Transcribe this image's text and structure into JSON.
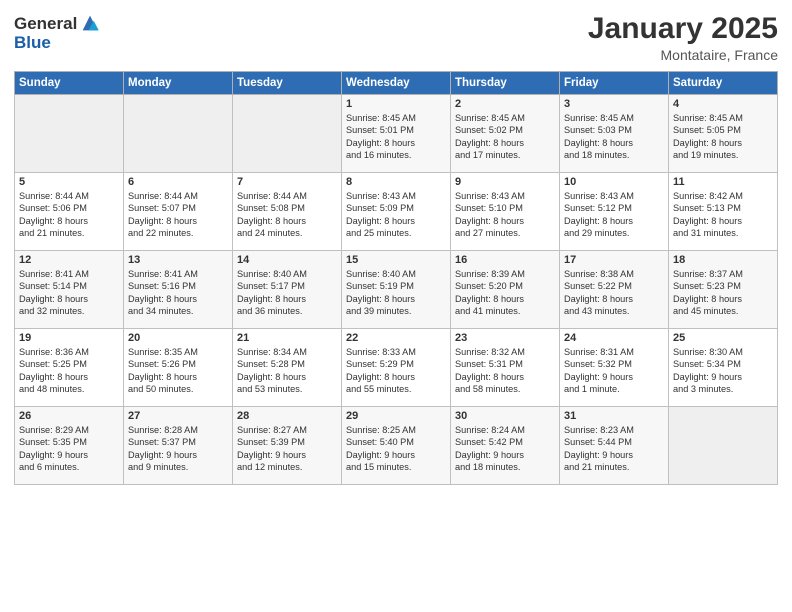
{
  "header": {
    "logo_general": "General",
    "logo_blue": "Blue",
    "month_title": "January 2025",
    "location": "Montataire, France"
  },
  "days_of_week": [
    "Sunday",
    "Monday",
    "Tuesday",
    "Wednesday",
    "Thursday",
    "Friday",
    "Saturday"
  ],
  "weeks": [
    [
      {
        "day": "",
        "content": ""
      },
      {
        "day": "",
        "content": ""
      },
      {
        "day": "",
        "content": ""
      },
      {
        "day": "1",
        "content": "Sunrise: 8:45 AM\nSunset: 5:01 PM\nDaylight: 8 hours\nand 16 minutes."
      },
      {
        "day": "2",
        "content": "Sunrise: 8:45 AM\nSunset: 5:02 PM\nDaylight: 8 hours\nand 17 minutes."
      },
      {
        "day": "3",
        "content": "Sunrise: 8:45 AM\nSunset: 5:03 PM\nDaylight: 8 hours\nand 18 minutes."
      },
      {
        "day": "4",
        "content": "Sunrise: 8:45 AM\nSunset: 5:05 PM\nDaylight: 8 hours\nand 19 minutes."
      }
    ],
    [
      {
        "day": "5",
        "content": "Sunrise: 8:44 AM\nSunset: 5:06 PM\nDaylight: 8 hours\nand 21 minutes."
      },
      {
        "day": "6",
        "content": "Sunrise: 8:44 AM\nSunset: 5:07 PM\nDaylight: 8 hours\nand 22 minutes."
      },
      {
        "day": "7",
        "content": "Sunrise: 8:44 AM\nSunset: 5:08 PM\nDaylight: 8 hours\nand 24 minutes."
      },
      {
        "day": "8",
        "content": "Sunrise: 8:43 AM\nSunset: 5:09 PM\nDaylight: 8 hours\nand 25 minutes."
      },
      {
        "day": "9",
        "content": "Sunrise: 8:43 AM\nSunset: 5:10 PM\nDaylight: 8 hours\nand 27 minutes."
      },
      {
        "day": "10",
        "content": "Sunrise: 8:43 AM\nSunset: 5:12 PM\nDaylight: 8 hours\nand 29 minutes."
      },
      {
        "day": "11",
        "content": "Sunrise: 8:42 AM\nSunset: 5:13 PM\nDaylight: 8 hours\nand 31 minutes."
      }
    ],
    [
      {
        "day": "12",
        "content": "Sunrise: 8:41 AM\nSunset: 5:14 PM\nDaylight: 8 hours\nand 32 minutes."
      },
      {
        "day": "13",
        "content": "Sunrise: 8:41 AM\nSunset: 5:16 PM\nDaylight: 8 hours\nand 34 minutes."
      },
      {
        "day": "14",
        "content": "Sunrise: 8:40 AM\nSunset: 5:17 PM\nDaylight: 8 hours\nand 36 minutes."
      },
      {
        "day": "15",
        "content": "Sunrise: 8:40 AM\nSunset: 5:19 PM\nDaylight: 8 hours\nand 39 minutes."
      },
      {
        "day": "16",
        "content": "Sunrise: 8:39 AM\nSunset: 5:20 PM\nDaylight: 8 hours\nand 41 minutes."
      },
      {
        "day": "17",
        "content": "Sunrise: 8:38 AM\nSunset: 5:22 PM\nDaylight: 8 hours\nand 43 minutes."
      },
      {
        "day": "18",
        "content": "Sunrise: 8:37 AM\nSunset: 5:23 PM\nDaylight: 8 hours\nand 45 minutes."
      }
    ],
    [
      {
        "day": "19",
        "content": "Sunrise: 8:36 AM\nSunset: 5:25 PM\nDaylight: 8 hours\nand 48 minutes."
      },
      {
        "day": "20",
        "content": "Sunrise: 8:35 AM\nSunset: 5:26 PM\nDaylight: 8 hours\nand 50 minutes."
      },
      {
        "day": "21",
        "content": "Sunrise: 8:34 AM\nSunset: 5:28 PM\nDaylight: 8 hours\nand 53 minutes."
      },
      {
        "day": "22",
        "content": "Sunrise: 8:33 AM\nSunset: 5:29 PM\nDaylight: 8 hours\nand 55 minutes."
      },
      {
        "day": "23",
        "content": "Sunrise: 8:32 AM\nSunset: 5:31 PM\nDaylight: 8 hours\nand 58 minutes."
      },
      {
        "day": "24",
        "content": "Sunrise: 8:31 AM\nSunset: 5:32 PM\nDaylight: 9 hours\nand 1 minute."
      },
      {
        "day": "25",
        "content": "Sunrise: 8:30 AM\nSunset: 5:34 PM\nDaylight: 9 hours\nand 3 minutes."
      }
    ],
    [
      {
        "day": "26",
        "content": "Sunrise: 8:29 AM\nSunset: 5:35 PM\nDaylight: 9 hours\nand 6 minutes."
      },
      {
        "day": "27",
        "content": "Sunrise: 8:28 AM\nSunset: 5:37 PM\nDaylight: 9 hours\nand 9 minutes."
      },
      {
        "day": "28",
        "content": "Sunrise: 8:27 AM\nSunset: 5:39 PM\nDaylight: 9 hours\nand 12 minutes."
      },
      {
        "day": "29",
        "content": "Sunrise: 8:25 AM\nSunset: 5:40 PM\nDaylight: 9 hours\nand 15 minutes."
      },
      {
        "day": "30",
        "content": "Sunrise: 8:24 AM\nSunset: 5:42 PM\nDaylight: 9 hours\nand 18 minutes."
      },
      {
        "day": "31",
        "content": "Sunrise: 8:23 AM\nSunset: 5:44 PM\nDaylight: 9 hours\nand 21 minutes."
      },
      {
        "day": "",
        "content": ""
      }
    ]
  ]
}
